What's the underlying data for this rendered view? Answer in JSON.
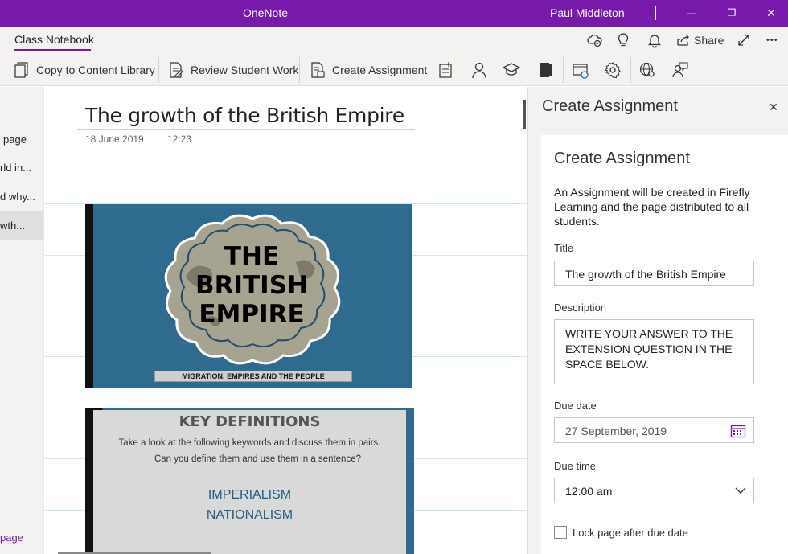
{
  "titlebar": {
    "app_title": "OneNote",
    "user_name": "Paul Middleton",
    "minimize_glyph": "—",
    "restore_glyph": "❐",
    "close_glyph": "✕"
  },
  "ribbon": {
    "active_tab": "Class Notebook",
    "share_label": "Share",
    "more_glyph": "•••",
    "accent_color": "#7719aa"
  },
  "commands": {
    "copy_to_content_library": "Copy to Content Library",
    "review_student_work": "Review Student Work",
    "create_assignment": "Create Assignment"
  },
  "pagelist": {
    "items": [
      {
        "label": "page"
      },
      {
        "label": "rld in..."
      },
      {
        "label": "d why..."
      },
      {
        "label": "wth..."
      }
    ],
    "add_page": "page"
  },
  "page": {
    "title": "The growth of the British Empire",
    "date": "18 June 2019",
    "time": "12:23",
    "image1": {
      "line1": "THE",
      "line2": "BRITISH",
      "line3": "EMPIRE",
      "banner": "MIGRATION, EMPIRES AND THE PEOPLE"
    },
    "image2": {
      "heading": "KEY DEFINITIONS",
      "line1": "Take a look at the following keywords and discuss them in pairs.",
      "line2": "Can you define them and use them in a sentence?",
      "word1": "IMPERIALISM",
      "word2": "NATIONALISM"
    }
  },
  "pane": {
    "title": "Create Assignment",
    "close_glyph": "✕",
    "card_heading": "Create Assignment",
    "description_text": "An Assignment will be created in Firefly Learning and the page distributed to all students.",
    "title_label": "Title",
    "title_value": "The growth of the British Empire",
    "description_label": "Description",
    "description_value": "WRITE YOUR ANSWER TO THE EXTENSION QUESTION IN THE SPACE BELOW.",
    "due_date_label": "Due date",
    "due_date_value": "27 September, 2019",
    "due_time_label": "Due time",
    "due_time_value": "12:00 am",
    "lock_label": "Lock page after due date"
  }
}
